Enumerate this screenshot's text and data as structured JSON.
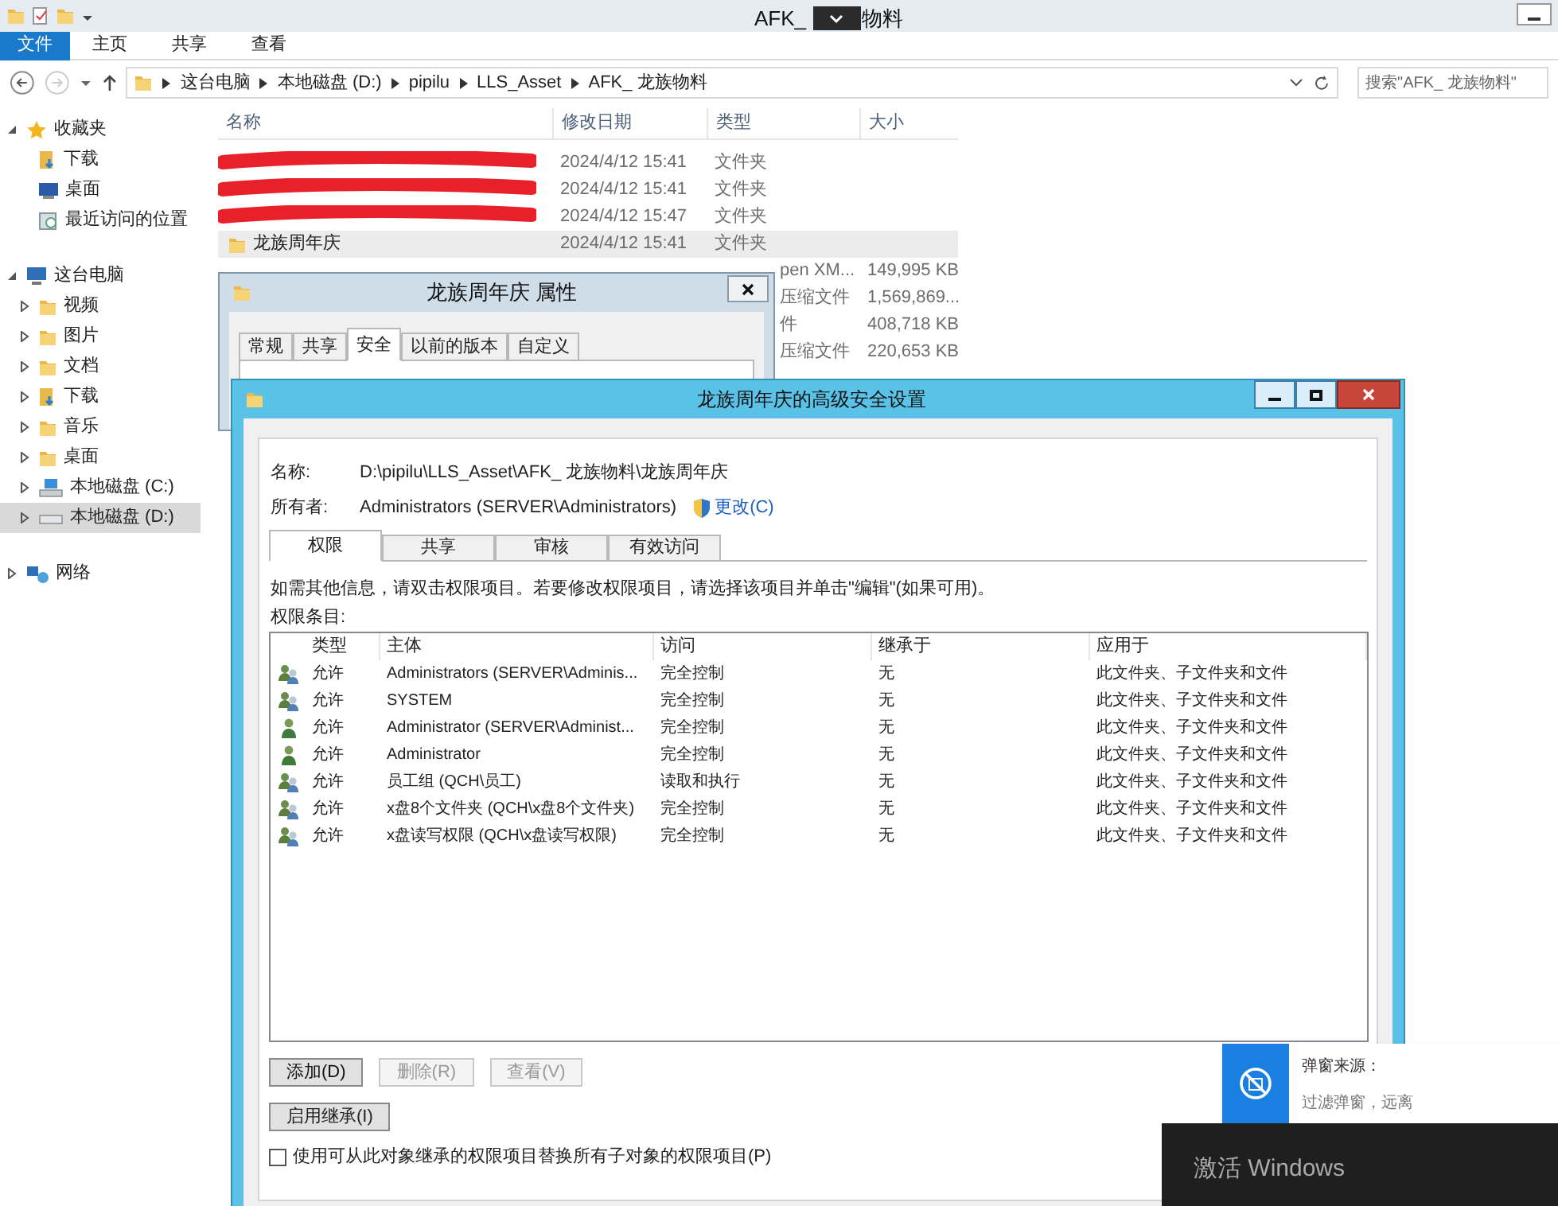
{
  "explorer": {
    "title_left": "AFK_",
    "title_right": "物料",
    "ribbon_tabs": [
      {
        "label": "文件",
        "selected": true
      },
      {
        "label": "主页",
        "selected": false
      },
      {
        "label": "共享",
        "selected": false
      },
      {
        "label": "查看",
        "selected": false
      }
    ],
    "breadcrumb": [
      "这台电脑",
      "本地磁盘 (D:)",
      "pipilu",
      "LLS_Asset",
      "AFK_ 龙族物料"
    ],
    "search": {
      "placeholder": "搜索\"AFK_ 龙族物料\""
    },
    "nav": [
      {
        "label": "收藏夹",
        "kind": "star",
        "expanded": true,
        "selected": false,
        "children": [
          {
            "label": "下载",
            "kind": "download",
            "selected": false
          },
          {
            "label": "桌面",
            "kind": "desktop",
            "selected": false
          },
          {
            "label": "最近访问的位置",
            "kind": "recent",
            "selected": false
          }
        ]
      },
      {
        "label": "这台电脑",
        "kind": "computer",
        "expanded": true,
        "selected": false,
        "children": [
          {
            "label": "视频",
            "kind": "folder",
            "expanded": false,
            "selected": false
          },
          {
            "label": "图片",
            "kind": "folder",
            "expanded": false,
            "selected": false
          },
          {
            "label": "文档",
            "kind": "folder",
            "expanded": false,
            "selected": false
          },
          {
            "label": "下载",
            "kind": "download",
            "expanded": false,
            "selected": false
          },
          {
            "label": "音乐",
            "kind": "folder",
            "expanded": false,
            "selected": false
          },
          {
            "label": "桌面",
            "kind": "folder",
            "expanded": false,
            "selected": false
          },
          {
            "label": "本地磁盘 (C:)",
            "kind": "systemdrive",
            "expanded": false,
            "selected": false
          },
          {
            "label": "本地磁盘 (D:)",
            "kind": "drive",
            "expanded": false,
            "selected": true
          }
        ]
      },
      {
        "label": "网络",
        "kind": "network",
        "expanded": false,
        "selected": false
      }
    ],
    "columns": [
      "名称",
      "修改日期",
      "类型",
      "大小"
    ],
    "files": [
      {
        "redacted": true,
        "date": "2024/4/12 15:41",
        "type": "文件夹",
        "selected": false
      },
      {
        "redacted": true,
        "date": "2024/4/12 15:41",
        "type": "文件夹",
        "selected": false
      },
      {
        "redacted": true,
        "date": "2024/4/12 15:47",
        "type": "文件夹",
        "selected": false
      },
      {
        "name": "龙族周年庆",
        "date": "2024/4/12 15:41",
        "type": "文件夹",
        "selected": true
      },
      {
        "type": "pen XM...",
        "size": "149,995 KB",
        "selected": false
      },
      {
        "type": "压缩文件",
        "size": "1,569,869...",
        "selected": false
      },
      {
        "type": "件",
        "size": "408,718 KB",
        "selected": false
      },
      {
        "type": "压缩文件",
        "size": "220,653 KB",
        "selected": false
      }
    ]
  },
  "properties": {
    "title": "龙族周年庆 属性",
    "tabs": [
      {
        "label": "常规",
        "selected": false
      },
      {
        "label": "共享",
        "selected": false
      },
      {
        "label": "安全",
        "selected": true
      },
      {
        "label": "以前的版本",
        "selected": false
      },
      {
        "label": "自定义",
        "selected": false
      }
    ]
  },
  "advanced": {
    "title": "龙族周年庆的高级安全设置",
    "name_label": "名称:",
    "name_value": "D:\\pipilu\\LLS_Asset\\AFK_ 龙族物料\\龙族周年庆",
    "owner_label": "所有者:",
    "owner_value": "Administrators (SERVER\\Administrators)",
    "change_link": "更改(C)",
    "tabs": [
      {
        "label": "权限",
        "selected": true
      },
      {
        "label": "共享",
        "selected": false
      },
      {
        "label": "审核",
        "selected": false
      },
      {
        "label": "有效访问",
        "selected": false
      }
    ],
    "info": "如需其他信息，请双击权限项目。若要修改权限项目，请选择该项目并单击\"编辑\"(如果可用)。",
    "entries_label": "权限条目:",
    "columns": [
      "类型",
      "主体",
      "访问",
      "继承于",
      "应用于"
    ],
    "rows": [
      {
        "kind": "group",
        "type": "允许",
        "principal": "Administrators (SERVER\\Adminis...",
        "access": "完全控制",
        "inherited": "无",
        "applies": "此文件夹、子文件夹和文件"
      },
      {
        "kind": "group",
        "type": "允许",
        "principal": "SYSTEM",
        "access": "完全控制",
        "inherited": "无",
        "applies": "此文件夹、子文件夹和文件"
      },
      {
        "kind": "user",
        "type": "允许",
        "principal": "Administrator (SERVER\\Administ...",
        "access": "完全控制",
        "inherited": "无",
        "applies": "此文件夹、子文件夹和文件"
      },
      {
        "kind": "user",
        "type": "允许",
        "principal": "Administrator",
        "access": "完全控制",
        "inherited": "无",
        "applies": "此文件夹、子文件夹和文件"
      },
      {
        "kind": "group",
        "type": "允许",
        "principal": "员工组 (QCH\\员工)",
        "access": "读取和执行",
        "inherited": "无",
        "applies": "此文件夹、子文件夹和文件"
      },
      {
        "kind": "group",
        "type": "允许",
        "principal": "x盘8个文件夹 (QCH\\x盘8个文件夹)",
        "access": "完全控制",
        "inherited": "无",
        "applies": "此文件夹、子文件夹和文件"
      },
      {
        "kind": "group",
        "type": "允许",
        "principal": "x盘读写权限 (QCH\\x盘读写权限)",
        "access": "完全控制",
        "inherited": "无",
        "applies": "此文件夹、子文件夹和文件"
      }
    ],
    "buttons": [
      {
        "label": "添加(D)",
        "disabled": false
      },
      {
        "label": "删除(R)",
        "disabled": true
      },
      {
        "label": "查看(V)",
        "disabled": true
      }
    ],
    "inherit_button": "启用继承(I)",
    "replace_checkbox": {
      "label": "使用可从此对象继承的权限项目替换所有子对象的权限项目(P)",
      "checked": false
    }
  },
  "popup": {
    "source_label": "弹窗来源：",
    "filter_text": "过滤弹窗，远离"
  },
  "activation": {
    "text": "激活 Windows"
  }
}
